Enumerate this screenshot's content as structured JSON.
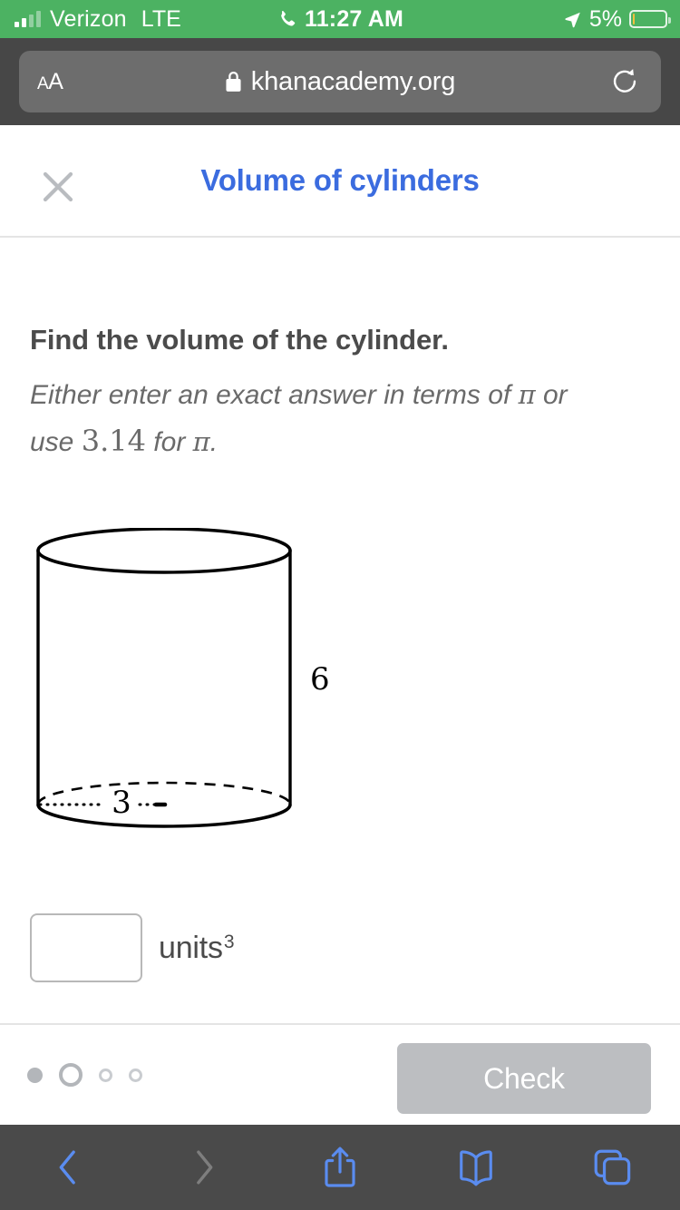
{
  "status_bar": {
    "carrier": "Verizon",
    "network": "LTE",
    "time": "11:27 AM",
    "battery_percent": "5%",
    "battery_level": 5,
    "in_call": true,
    "background_color": "#4cb262",
    "signal_bars_filled": 2,
    "signal_bars_total": 4,
    "icons": {
      "phone": "phone-icon",
      "location": "location-arrow-icon",
      "battery": "battery-icon",
      "signal": "signal-bars-icon"
    }
  },
  "browser": {
    "chrome_color": "#474747",
    "url_pill_color": "#6d6d6d",
    "text_size_button": "AA",
    "url": "khanacademy.org",
    "secure": true,
    "icons": {
      "lock": "lock-icon",
      "reload": "reload-icon",
      "text_size": "text-size-icon"
    },
    "toolbar": [
      {
        "name": "back",
        "icon": "chevron-left-icon",
        "enabled": true
      },
      {
        "name": "forward",
        "icon": "chevron-right-icon",
        "enabled": false
      },
      {
        "name": "share",
        "icon": "share-icon",
        "enabled": true
      },
      {
        "name": "bookmarks",
        "icon": "book-icon",
        "enabled": true
      },
      {
        "name": "tabs",
        "icon": "tabs-icon",
        "enabled": true
      }
    ],
    "toolbar_color": "#4a4a4a",
    "accent_color": "#5a8cf0"
  },
  "exercise": {
    "title": "Volume of cylinders",
    "title_color": "#3b6cdf",
    "close_icon": "close-icon",
    "prompt_line1": "Find the volume of the cylinder.",
    "prompt_line2_a": "Either enter an exact answer in terms of ",
    "prompt_line2_pi": "π",
    "prompt_line2_b": " or",
    "prompt_line3_a": "use ",
    "prompt_line3_num": "3.14",
    "prompt_line3_b": " for ",
    "prompt_line3_pi": "π",
    "prompt_line3_c": "."
  },
  "figure": {
    "shape": "cylinder",
    "height_label": "6",
    "radius_label": "3",
    "height_value": 6,
    "radius_value": 3,
    "stroke_color": "#000000",
    "hidden_edge_style": "dashed",
    "radius_arrow_style": "dotted"
  },
  "answer": {
    "value": "",
    "placeholder": "",
    "units_text": "units",
    "units_exponent": "3"
  },
  "footer": {
    "progress": {
      "total": 4,
      "current_index": 1,
      "states": [
        "filled",
        "current",
        "empty",
        "empty"
      ]
    },
    "check_label": "Check",
    "check_enabled": false,
    "check_color": "#bcbec1"
  }
}
